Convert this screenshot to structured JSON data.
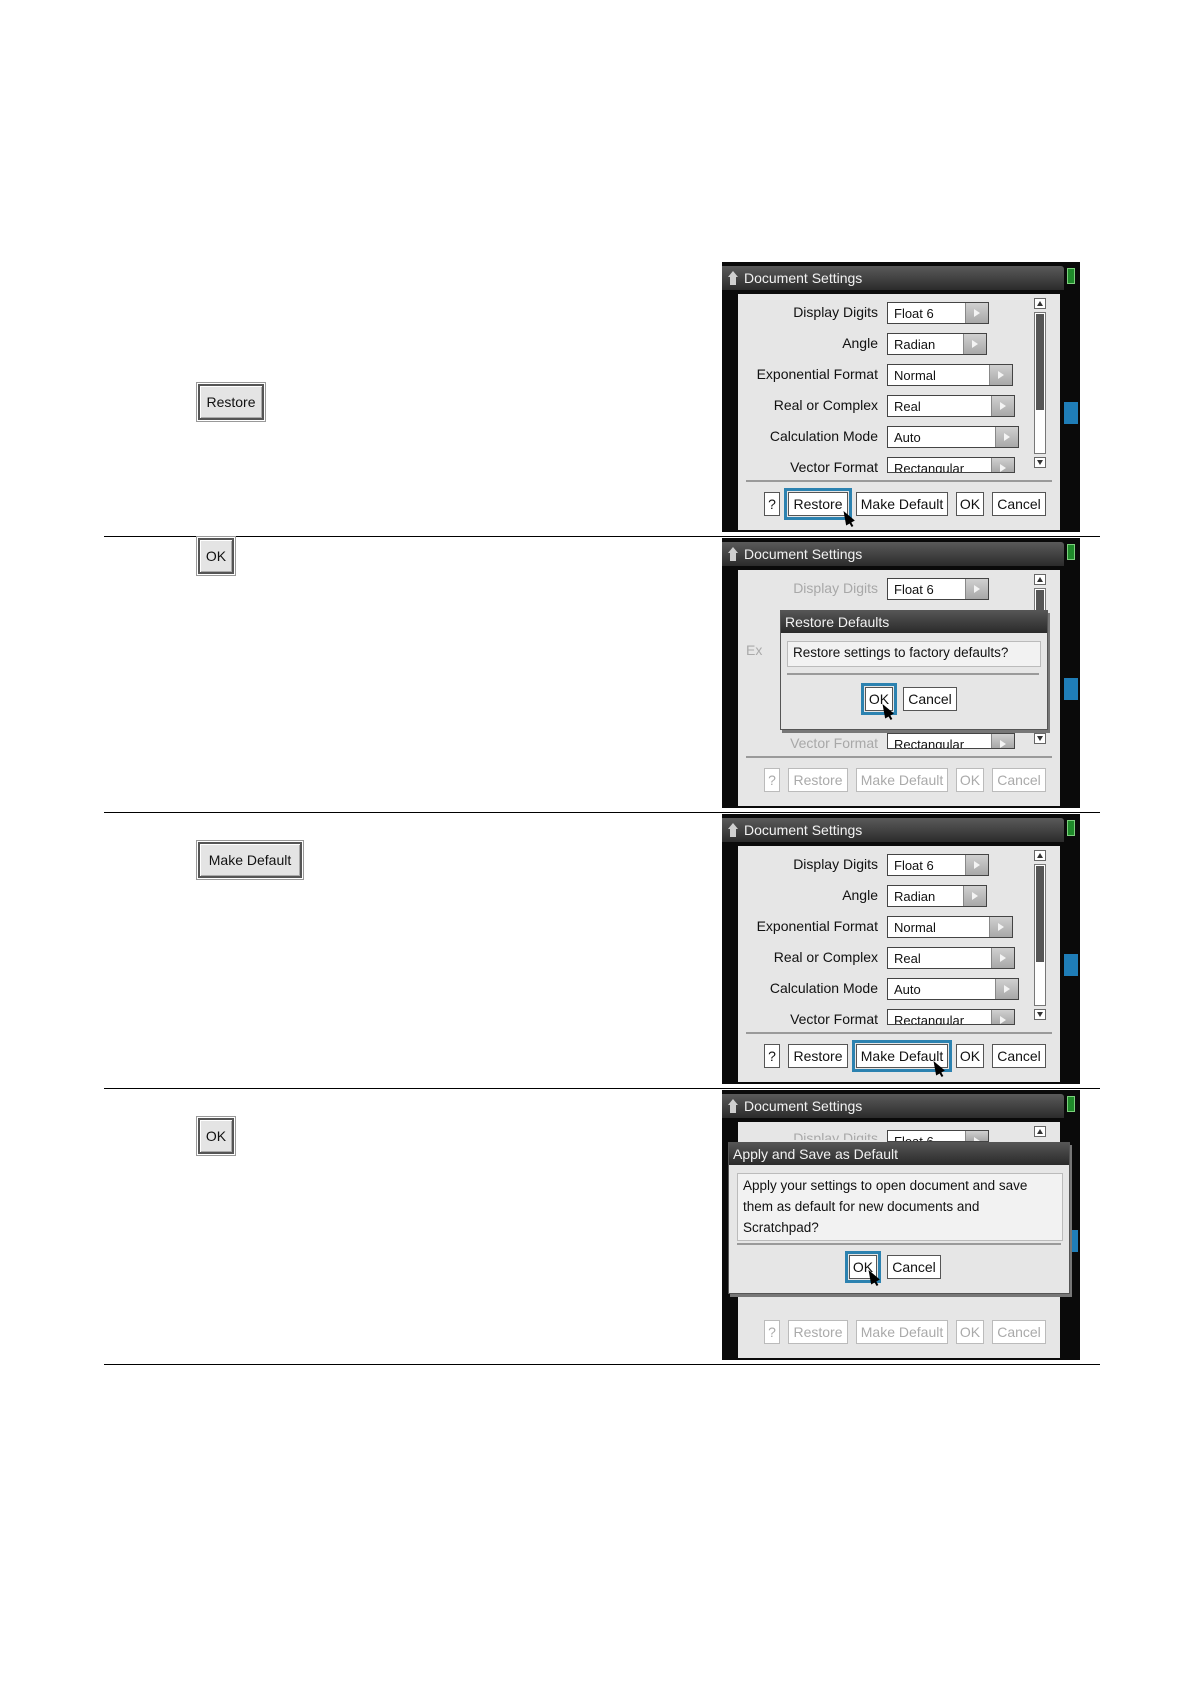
{
  "left_buttons": {
    "restore": "Restore",
    "ok_1": "OK",
    "make_default": "Make Default",
    "ok_2": "OK"
  },
  "screen": {
    "title": "Document Settings",
    "rows": [
      {
        "label": "Display Digits",
        "value": "Float 6"
      },
      {
        "label": "Angle",
        "value": "Radian"
      },
      {
        "label": "Exponential Format",
        "value": "Normal"
      },
      {
        "label": "Real or Complex",
        "value": "Real"
      },
      {
        "label": "Calculation Mode",
        "value": "Auto"
      },
      {
        "label": "Vector Format",
        "value": "Rectangular"
      }
    ],
    "partial_label": "Ex",
    "buttons": {
      "help": "?",
      "restore": "Restore",
      "make_default": "Make Default",
      "ok": "OK",
      "cancel": "Cancel"
    }
  },
  "dialog_restore": {
    "title": "Restore Defaults",
    "message": "Restore settings to factory defaults?",
    "ok": "OK",
    "cancel": "Cancel"
  },
  "dialog_apply": {
    "title": "Apply and Save as Default",
    "message_lines": [
      "Apply your settings to open document and save",
      "them as default for new documents and",
      "Scratchpad?"
    ],
    "ok": "OK",
    "cancel": "Cancel"
  },
  "colors": {
    "focus_outline": "#2c82b0",
    "battery": "#1f8a2a",
    "side_tab": "#1f7db7"
  }
}
